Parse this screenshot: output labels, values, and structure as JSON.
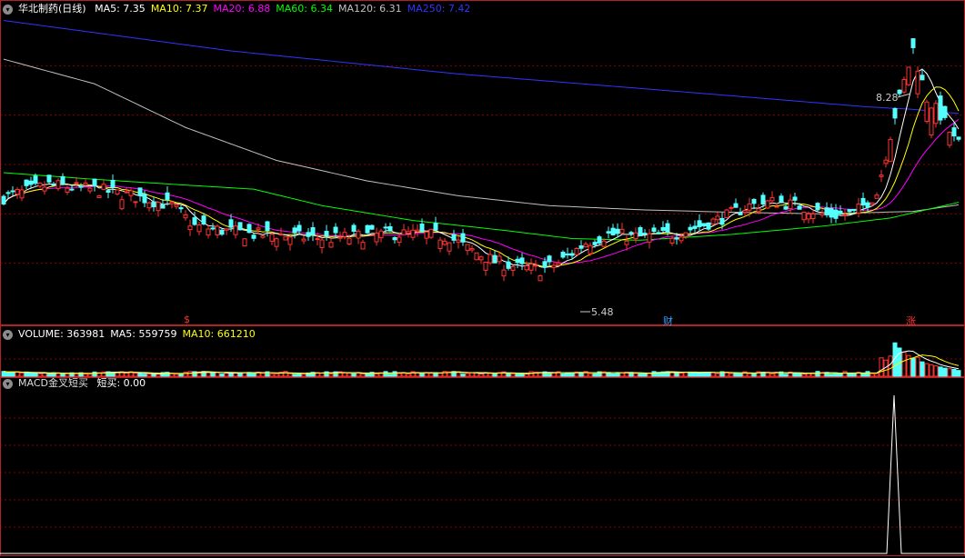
{
  "price_panel": {
    "title": "华北制药(日线)",
    "ma": [
      {
        "label": "MA5: 7.35",
        "color": "#ffffff"
      },
      {
        "label": "MA10: 7.37",
        "color": "#ffff00"
      },
      {
        "label": "MA20: 6.88",
        "color": "#ff00ff"
      },
      {
        "label": "MA60: 6.34",
        "color": "#00ff00"
      },
      {
        "label": "MA120: 6.31",
        "color": "#c0c0c0"
      },
      {
        "label": "MA250: 7.42",
        "color": "#3333ff"
      }
    ],
    "high_label": "8.28",
    "low_label": "5.48",
    "markers": [
      {
        "text": "$",
        "color": "#ff3333"
      },
      {
        "text": "财",
        "color": "#3aa0ff"
      },
      {
        "text": "涨",
        "color": "#ff3333"
      }
    ]
  },
  "volume_panel": {
    "labels": [
      {
        "text": "VOLUME: 363981",
        "color": "#ffffff"
      },
      {
        "text": "MA5: 559759",
        "color": "#ffffff"
      },
      {
        "text": "MA10: 661210",
        "color": "#ffff00"
      }
    ]
  },
  "indicator_panel": {
    "title": "MACD金叉短买",
    "value_label": "短买: 0.00"
  },
  "colors": {
    "up": "#ff3333",
    "down": "#54ffff",
    "grid": "#8b0000",
    "border": "#b22222"
  },
  "chart_data": {
    "type": "candlestick",
    "price_range": [
      5.0,
      8.6
    ],
    "close_anchors": [
      [
        0,
        6.4
      ],
      [
        10,
        6.55
      ],
      [
        22,
        6.48
      ],
      [
        30,
        6.4
      ],
      [
        37,
        6.3
      ],
      [
        42,
        6.05
      ],
      [
        48,
        6.0
      ],
      [
        55,
        5.95
      ],
      [
        60,
        5.95
      ],
      [
        65,
        5.92
      ],
      [
        72,
        5.9
      ],
      [
        78,
        5.93
      ],
      [
        85,
        5.96
      ],
      [
        92,
        5.95
      ],
      [
        98,
        5.92
      ],
      [
        102,
        5.78
      ],
      [
        108,
        5.62
      ],
      [
        113,
        5.55
      ],
      [
        118,
        5.52
      ],
      [
        122,
        5.6
      ],
      [
        128,
        5.85
      ],
      [
        133,
        5.95
      ],
      [
        140,
        5.92
      ],
      [
        147,
        5.95
      ],
      [
        153,
        6.05
      ],
      [
        158,
        6.15
      ],
      [
        164,
        6.3
      ],
      [
        170,
        6.35
      ],
      [
        176,
        6.28
      ],
      [
        181,
        6.18
      ],
      [
        187,
        6.2
      ],
      [
        192,
        6.45
      ],
      [
        196,
        7.4
      ],
      [
        200,
        8.2
      ],
      [
        203,
        7.6
      ],
      [
        206,
        7.4
      ],
      [
        209,
        7.1
      ],
      [
        210,
        7.05
      ]
    ],
    "ma_curves": [
      {
        "name": "MA250",
        "points": [
          [
            0,
            8.55
          ],
          [
            50,
            8.18
          ],
          [
            100,
            7.9
          ],
          [
            150,
            7.68
          ],
          [
            190,
            7.5
          ],
          [
            200,
            7.47
          ],
          [
            210,
            7.42
          ]
        ]
      },
      {
        "name": "MA120",
        "points": [
          [
            0,
            8.08
          ],
          [
            20,
            7.78
          ],
          [
            40,
            7.25
          ],
          [
            60,
            6.85
          ],
          [
            80,
            6.6
          ],
          [
            100,
            6.42
          ],
          [
            120,
            6.3
          ],
          [
            140,
            6.25
          ],
          [
            160,
            6.22
          ],
          [
            180,
            6.2
          ],
          [
            200,
            6.23
          ],
          [
            210,
            6.31
          ]
        ]
      },
      {
        "name": "MA60",
        "points": [
          [
            0,
            6.7
          ],
          [
            20,
            6.62
          ],
          [
            40,
            6.55
          ],
          [
            55,
            6.5
          ],
          [
            70,
            6.3
          ],
          [
            90,
            6.12
          ],
          [
            110,
            6.0
          ],
          [
            125,
            5.9
          ],
          [
            140,
            5.88
          ],
          [
            160,
            5.95
          ],
          [
            180,
            6.05
          ],
          [
            195,
            6.15
          ],
          [
            210,
            6.34
          ]
        ]
      }
    ],
    "volume_spikes": [
      [
        193,
        3.2
      ],
      [
        194,
        2.8
      ],
      [
        195,
        3.5
      ],
      [
        196,
        5.8
      ],
      [
        197,
        4.9
      ],
      [
        198,
        4.2
      ],
      [
        199,
        3.6
      ],
      [
        200,
        3.1
      ],
      [
        201,
        3.3
      ],
      [
        202,
        2.5
      ],
      [
        203,
        2.2
      ],
      [
        204,
        2.0
      ],
      [
        205,
        1.8
      ],
      [
        206,
        1.6
      ],
      [
        207,
        1.4
      ],
      [
        208,
        1.3
      ],
      [
        209,
        1.2
      ],
      [
        210,
        1.0
      ]
    ],
    "indicator": {
      "name": "短买",
      "signal_bars": [
        196
      ]
    }
  }
}
